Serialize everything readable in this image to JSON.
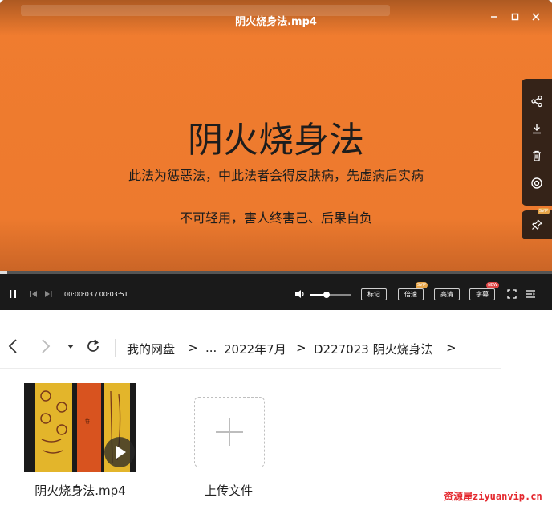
{
  "player": {
    "window_title": "阴火烧身法.mp4",
    "slide": {
      "title": "阴火烧身法",
      "line1": "此法为惩恶法，中此法者会得皮肤病，先虚病后实病",
      "line2": "不可轻用，害人终害己、后果自负"
    },
    "side_tools": [
      "share-icon",
      "download-icon",
      "delete-icon",
      "target-icon"
    ],
    "pin_badge": "SVIP",
    "time": "00:00:03 / 00:03:51",
    "progress": 0.013,
    "volume": 0.4,
    "buttons": {
      "mark": "标记",
      "speed": "倍速",
      "speed_badge": "SVIP",
      "quality": "高清",
      "subtitle": "字幕",
      "subtitle_badge": "NEW"
    }
  },
  "browser": {
    "breadcrumb": [
      "我的网盘",
      "...",
      "2022年7月",
      "D227023 阴火烧身法"
    ],
    "file": {
      "name": "阴火烧身法.mp4"
    },
    "upload_label": "上传文件"
  },
  "watermark": "资源屋ziyuanvip.cn",
  "colors": {
    "video_bg": "#ef7b2e",
    "controls_bg": "#1a1a1a",
    "watermark": "#e4282e"
  }
}
